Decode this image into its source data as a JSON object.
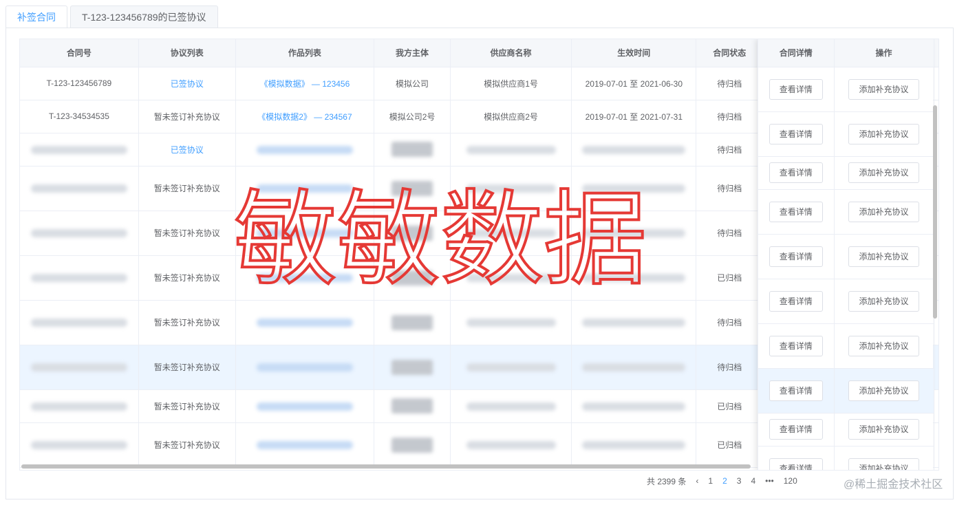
{
  "tabs": [
    {
      "label": "补签合同"
    },
    {
      "label": "T-123-123456789的已签协议"
    }
  ],
  "table": {
    "headers": [
      "合同号",
      "协议列表",
      "作品列表",
      "我方主体",
      "供应商名称",
      "生效时间",
      "合同状态",
      "合同详情",
      "操作"
    ],
    "rows": [
      {
        "contract": "T-123-123456789",
        "agreement": "已签协议",
        "works": "《模拟数据》 — 123456",
        "entity": "模拟公司",
        "supplier": "模拟供应商1号",
        "period": "2019-07-01 至 2021-06-30",
        "status": "待归档"
      },
      {
        "contract": "T-123-34534535",
        "agreement": "暂未签订补充协议",
        "works": "《模拟数据2》 — 234567",
        "entity": "模拟公司2号",
        "supplier": "模拟供应商2号",
        "period": "2019-07-01 至 2021-07-31",
        "status": "待归档"
      },
      {
        "agreement": "已签协议",
        "status": "待归档"
      },
      {
        "agreement": "暂未签订补充协议",
        "status": "待归档"
      },
      {
        "agreement": "暂未签订补充协议",
        "status": "待归档"
      },
      {
        "agreement": "暂未签订补充协议",
        "status": "已归档"
      },
      {
        "agreement": "暂未签订补充协议",
        "status": "待归档"
      },
      {
        "agreement": "暂未签订补充协议",
        "status": "待归档"
      },
      {
        "agreement": "暂未签订补充协议",
        "status": "已归档"
      },
      {
        "agreement": "暂未签订补充协议",
        "status": "已归档"
      }
    ],
    "detail_button": "查看详情",
    "add_button": "添加补充协议"
  },
  "pagination": {
    "total": "共 2399 条",
    "prev": "‹",
    "pages": [
      "1",
      "2",
      "3",
      "4"
    ],
    "current": "2",
    "ellipsis": "•••",
    "last": "120"
  },
  "overlay_text": "敏敏数据",
  "watermark": "@稀土掘金技术社区"
}
